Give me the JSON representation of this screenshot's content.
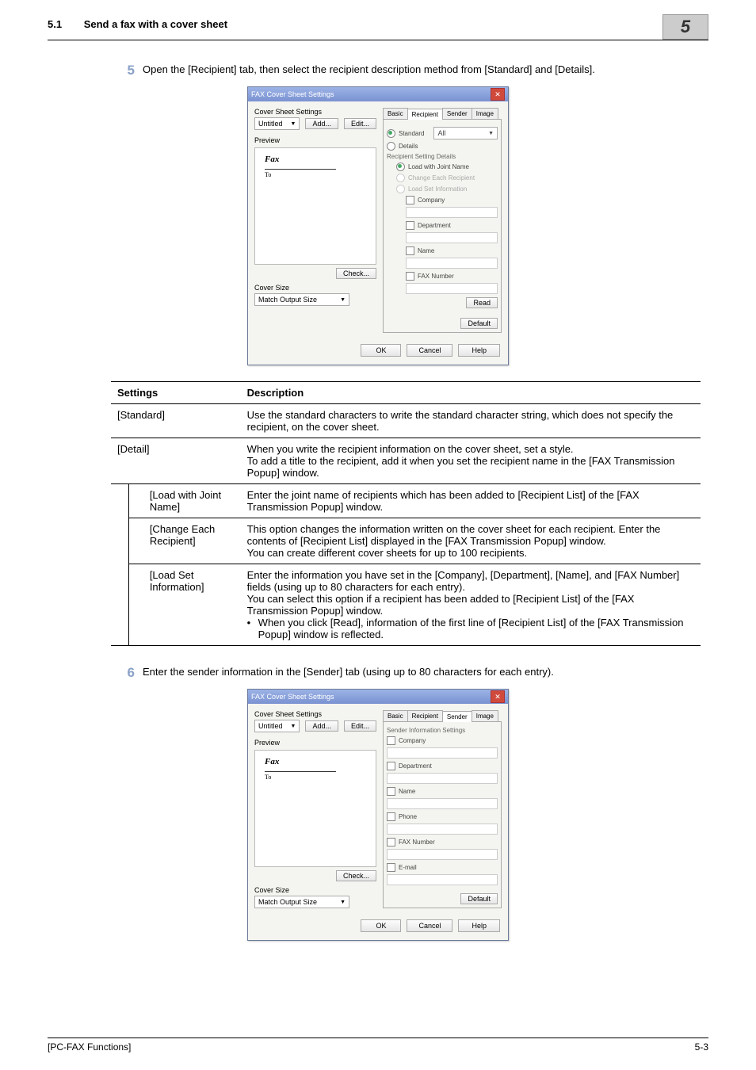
{
  "header": {
    "section_num": "5.1",
    "section_title": "Send a fax with a cover sheet",
    "chapter_badge": "5"
  },
  "step5": {
    "num": "5",
    "text": "Open the [Recipient] tab, then select the recipient description method from [Standard] and [Details]."
  },
  "dlg1": {
    "title": "FAX Cover Sheet Settings",
    "css_label": "Cover Sheet Settings",
    "select_value": "Untitled",
    "add": "Add...",
    "edit": "Edit...",
    "preview_label": "Preview",
    "preview_title": "Fax",
    "preview_to": "To",
    "check": "Check...",
    "cover_size_label": "Cover Size",
    "cover_size_value": "Match Output Size",
    "tabs": {
      "basic": "Basic",
      "recipient": "Recipient",
      "sender": "Sender",
      "image": "Image"
    },
    "standard": "Standard",
    "standard_val": "All",
    "details": "Details",
    "rsd": "Recipient Setting Details",
    "load_joint": "Load with Joint Name",
    "change_each": "Change Each Recipient",
    "load_set": "Load Set Information",
    "company": "Company",
    "department": "Department",
    "name_f": "Name",
    "fax_number": "FAX Number",
    "read": "Read",
    "default": "Default",
    "ok": "OK",
    "cancel": "Cancel",
    "help": "Help"
  },
  "table": {
    "h1": "Settings",
    "h2": "Description",
    "r1a": "[Standard]",
    "r1b": "Use the standard characters to write the standard character string, which does not specify the recipient, on the cover sheet.",
    "r2a": "[Detail]",
    "r2b": "When you write the recipient information on the cover sheet, set a style.\nTo add a title to the recipient, add it when you set the recipient name in the [FAX Transmission Popup] window.",
    "r3a": "[Load with Joint Name]",
    "r3b": "Enter the joint name of recipients which has been added to [Recipient List] of the [FAX Transmission Popup] window.",
    "r4a": "[Change Each Recipient]",
    "r4b": "This option changes the information written on the cover sheet for each recipient. Enter the contents of [Recipient List] displayed in the [FAX Transmission Popup] window.\nYou can create different cover sheets for up to 100 recipients.",
    "r5a": "[Load Set Information]",
    "r5b_l1": "Enter the information you have set in the [Company], [Department], [Name], and [FAX Number] fields (using up to 80 characters for each entry).",
    "r5b_l2": "You can select this option if a recipient has been added to [Recipient List] of the [FAX Transmission Popup] window.",
    "r5b_bullet": "When you click [Read], information of the first line of [Recipient List] of the [FAX Transmission Popup] window is reflected."
  },
  "step6": {
    "num": "6",
    "text": "Enter the sender information in the [Sender] tab (using up to 80 characters for each entry)."
  },
  "dlg2": {
    "sis": "Sender Information Settings",
    "company": "Company",
    "department": "Department",
    "name_f": "Name",
    "phone": "Phone",
    "fax_number": "FAX Number",
    "email": "E-mail"
  },
  "footer": {
    "left": "[PC-FAX Functions]",
    "right": "5-3"
  }
}
